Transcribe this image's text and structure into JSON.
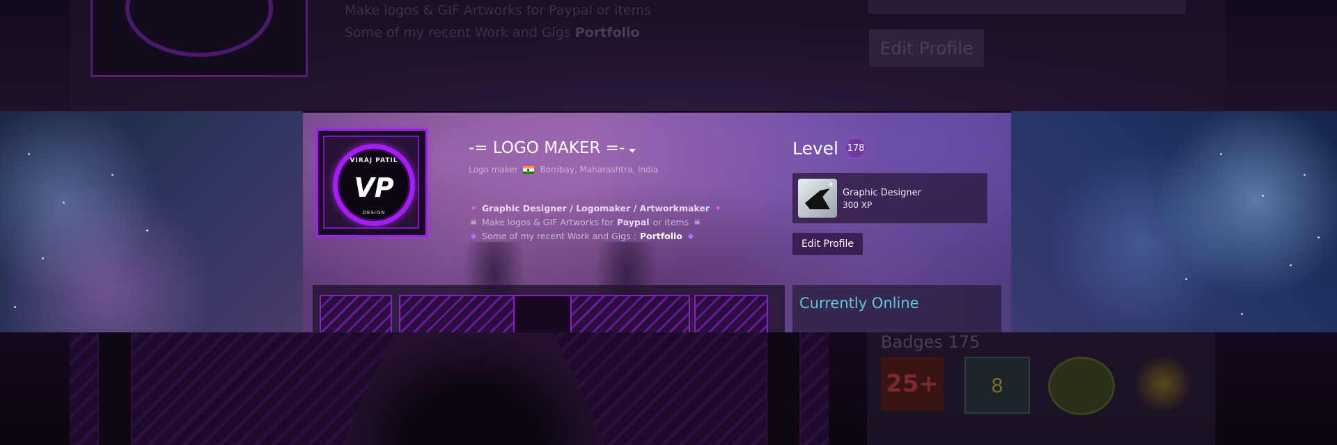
{
  "background": {
    "ghost_top": {
      "line1": "Make logos & GIF Artworks for Paypal or items",
      "line2_prefix": "Some of my recent Work and Gigs",
      "line2_link": "Portfolio",
      "edit_label": "Edit Profile"
    },
    "ghost_bottom": {
      "badges_title": "Badges",
      "badges_count": "175",
      "badge_25": "25+",
      "badge_8": "8"
    }
  },
  "profile": {
    "avatar": {
      "top_text": "VIRAJ PATIL",
      "logo_text": "VP",
      "bottom_text": "DESIGN"
    },
    "persona_name": "-= LOGO MAKER =-",
    "real_name": "Logo maker",
    "location": "Bombay, Maharashtra, India",
    "summary": {
      "line1": "Graphic Designer / Logomaker / Artworkmaker",
      "line2_prefix": "Make logos & GIF Artworks for",
      "line2_bold": "Paypal",
      "line2_suffix": "or items",
      "line3_prefix": "Some of my recent Work and Gigs :",
      "line3_link": "Portfolio"
    },
    "level": {
      "label": "Level",
      "value": "178"
    },
    "favorite_badge": {
      "name": "Graphic Designer",
      "xp": "300 XP"
    },
    "edit_profile_label": "Edit Profile",
    "status": "Currently Online"
  },
  "colors": {
    "accent_purple": "#a020f0",
    "online_blue": "#57cbde",
    "edit_button_bg": "#3a1f55"
  },
  "icons": [
    "pink-star-icon",
    "skull-icon",
    "diamond-icon",
    "dropdown-caret-icon",
    "flag-india-icon",
    "graphic-designer-badge-icon"
  ]
}
